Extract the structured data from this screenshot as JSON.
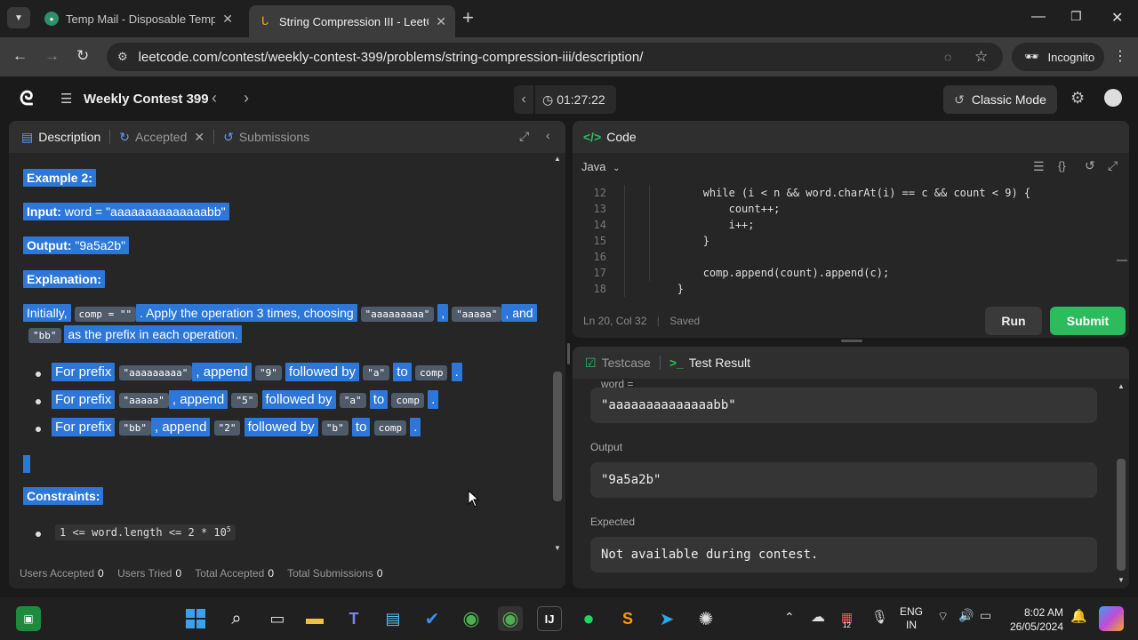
{
  "browser": {
    "tabs": [
      {
        "title": "Temp Mail - Disposable Tempor",
        "close": "✕"
      },
      {
        "title": "String Compression III - LeetCo",
        "close": "✕"
      }
    ],
    "new_tab": "+",
    "url": "leetcode.com/contest/weekly-contest-399/problems/string-compression-iii/description/",
    "incognito_label": "Incognito"
  },
  "contest_nav": {
    "contest_title": "Weekly Contest 399",
    "timer": "01:27:22",
    "mode_button": "Classic Mode"
  },
  "left_panel": {
    "tabs": [
      "Description",
      "Accepted",
      "Submissions"
    ],
    "example_title": "Example 2:",
    "input_label": "Input:",
    "input_value": "word = \"aaaaaaaaaaaaaabb\"",
    "output_label": "Output:",
    "output_value": "\"9a5a2b\"",
    "explanation_label": "Explanation:",
    "expl_p1": "Initially,",
    "expl_code_comp": "comp = \"\"",
    "expl_p2": ". Apply the operation 3 times, choosing",
    "expl_code_a9": "\"aaaaaaaaa\"",
    "expl_comma": ",",
    "expl_code_a5": "\"aaaaa\"",
    "expl_and": ", and",
    "expl_code_bb": "\"bb\"",
    "expl_p3": "as the prefix in each operation.",
    "bullets": [
      {
        "for": "For prefix",
        "prefix": "\"aaaaaaaaa\"",
        "append": ", append",
        "num": "\"9\"",
        "followed": "followed by",
        "ch": "\"a\"",
        "to": "to",
        "comp": "comp",
        "end": "."
      },
      {
        "for": "For prefix",
        "prefix": "\"aaaaa\"",
        "append": ", append",
        "num": "\"5\"",
        "followed": "followed by",
        "ch": "\"a\"",
        "to": "to",
        "comp": "comp",
        "end": "."
      },
      {
        "for": "For prefix",
        "prefix": "\"bb\"",
        "append": ", append",
        "num": "\"2\"",
        "followed": "followed by",
        "ch": "\"b\"",
        "to": "to",
        "comp": "comp",
        "end": "."
      }
    ],
    "constraints_label": "Constraints:",
    "constraint_1": "1 <= word.length <= 2 * 10",
    "constraint_1_exp": "5",
    "stats": {
      "users_accepted_label": "Users Accepted",
      "users_accepted": "0",
      "users_tried_label": "Users Tried",
      "users_tried": "0",
      "total_accepted_label": "Total Accepted",
      "total_accepted": "0",
      "total_submissions_label": "Total Submissions",
      "total_submissions": "0"
    }
  },
  "code_panel": {
    "title": "Code",
    "language": "Java",
    "lines": [
      {
        "n": "12",
        "t": "            while (i < n && word.charAt(i) == c && count < 9) {"
      },
      {
        "n": "13",
        "t": "                count++;"
      },
      {
        "n": "14",
        "t": "                i++;"
      },
      {
        "n": "15",
        "t": "            }"
      },
      {
        "n": "16",
        "t": ""
      },
      {
        "n": "17",
        "t": "            comp.append(count).append(c);"
      },
      {
        "n": "18",
        "t": "        }"
      }
    ],
    "cursor_pos": "Ln 20, Col 32",
    "save_state": "Saved",
    "run_label": "Run",
    "submit_label": "Submit"
  },
  "test_panel": {
    "tabs": [
      "Testcase",
      "Test Result"
    ],
    "word_label": "word =",
    "word_value": "\"aaaaaaaaaaaaaabb\"",
    "output_label": "Output",
    "output_value": "\"9a5a2b\"",
    "expected_label": "Expected",
    "expected_value": "Not available during contest."
  },
  "taskbar": {
    "lang_1": "ENG",
    "lang_2": "IN",
    "time": "8:02 AM",
    "date": "26/05/2024",
    "calendar_badge": "12"
  },
  "colors": {
    "selection": "#2c77d8",
    "submit": "#2cbb5d",
    "accent_green": "#2cbb5d"
  }
}
